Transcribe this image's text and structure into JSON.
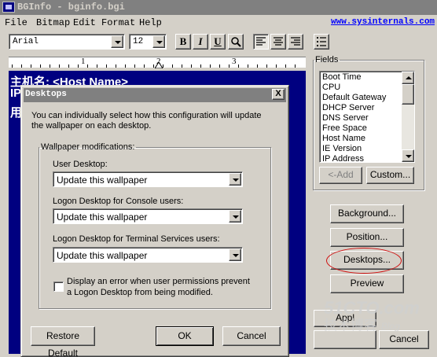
{
  "window": {
    "title": "BGInfo - bginfo.bgi"
  },
  "menu": {
    "items": [
      "File",
      "Bitmap",
      "Edit",
      "Format",
      "Help"
    ],
    "link": "www.sysinternals.com"
  },
  "toolbar": {
    "font": "Arial",
    "size": "12",
    "bold": "B",
    "italic": "I",
    "underline": "U",
    "icons": [
      "bold-icon",
      "italic-icon",
      "underline-icon",
      "insert-image-icon",
      "align-left-icon",
      "align-center-icon",
      "align-right-icon",
      "bullet-list-icon"
    ]
  },
  "ruler": {
    "marks": [
      "1",
      "2",
      "3"
    ]
  },
  "editor": {
    "lines": [
      "主机名: <Host Name>",
      "IP",
      "用"
    ]
  },
  "fields": {
    "label": "Fields",
    "items": [
      "Boot Time",
      "CPU",
      "Default Gateway",
      "DHCP Server",
      "DNS Server",
      "Free Space",
      "Host Name",
      "IE Version",
      "IP Address"
    ],
    "add_button": "<-Add",
    "custom_button": "Custom..."
  },
  "side_buttons": {
    "background": "Background...",
    "position": "Position...",
    "desktops": "Desktops...",
    "preview": "Preview"
  },
  "bottom_buttons": {
    "apply_partial": "Appl",
    "cancel": "Cancel"
  },
  "dialog": {
    "title": "Desktops",
    "close": "X",
    "description": "You can individually select how this configuration will update the wallpaper on each desktop.",
    "group_label": "Wallpaper modifications:",
    "user_desktop_label": "User Desktop:",
    "user_desktop_value": "Update this wallpaper",
    "console_label": "Logon Desktop for Console users:",
    "console_value": "Update this wallpaper",
    "terminal_label": "Logon Desktop for Terminal Services users:",
    "terminal_value": "Update this wallpaper",
    "checkbox_label": "Display an error when user permissions prevent a Logon Desktop from being modified.",
    "checkbox_checked": false,
    "restore_button": "Restore Default",
    "ok_button": "OK",
    "cancel_button": "Cancel"
  },
  "watermark": {
    "line1": "51CTO.com",
    "line2": "技术博客",
    "line3": "Blog"
  },
  "colors": {
    "editor_bg": "#000080",
    "title_inactive": "#808080",
    "link": "#0000ff",
    "annotation": "#d01010"
  }
}
